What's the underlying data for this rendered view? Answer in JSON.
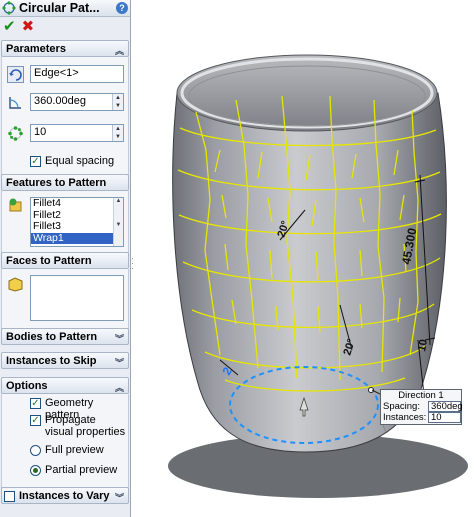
{
  "window": {
    "title": "Circular Pat..."
  },
  "toolbar": {
    "ok_glyph": "✔",
    "cancel_glyph": "✖"
  },
  "parameters": {
    "header": "Parameters",
    "axis_value": "Edge<1>",
    "angle_value": "360.00deg",
    "instances_value": "10",
    "equal_spacing_label": "Equal spacing",
    "equal_spacing_checked": true
  },
  "features": {
    "header": "Features to Pattern",
    "items": [
      "Fillet4",
      "Fillet2",
      "Fillet3",
      "Wrap1"
    ],
    "selected_index": 3
  },
  "faces": {
    "header": "Faces to Pattern"
  },
  "bodies": {
    "header": "Bodies to Pattern"
  },
  "skip": {
    "header": "Instances to Skip"
  },
  "options": {
    "header": "Options",
    "geometry_pattern_label": "Geometry pattern",
    "propagate_label": "Propagate visual properties",
    "full_preview_label": "Full preview",
    "partial_preview_label": "Partial preview",
    "selected_preview": "Partial preview"
  },
  "vary": {
    "header": "Instances to Vary"
  },
  "model": {
    "dim_height": "45.300",
    "angle_top": "20°",
    "angle_right": "20°",
    "dim_bottom": "10",
    "callout_marker": "2"
  },
  "direction": {
    "title": "Direction 1",
    "spacing_label": "Spacing:",
    "spacing_value": "360deg",
    "instances_label": "Instances:",
    "instances_value": "10"
  },
  "colors": {
    "accent_blue": "#3163c5",
    "ok_green": "#1f8a1f",
    "cancel_red": "#d01818",
    "preview_yellow": "#e6e600",
    "dim_blue": "#1e73ff"
  }
}
